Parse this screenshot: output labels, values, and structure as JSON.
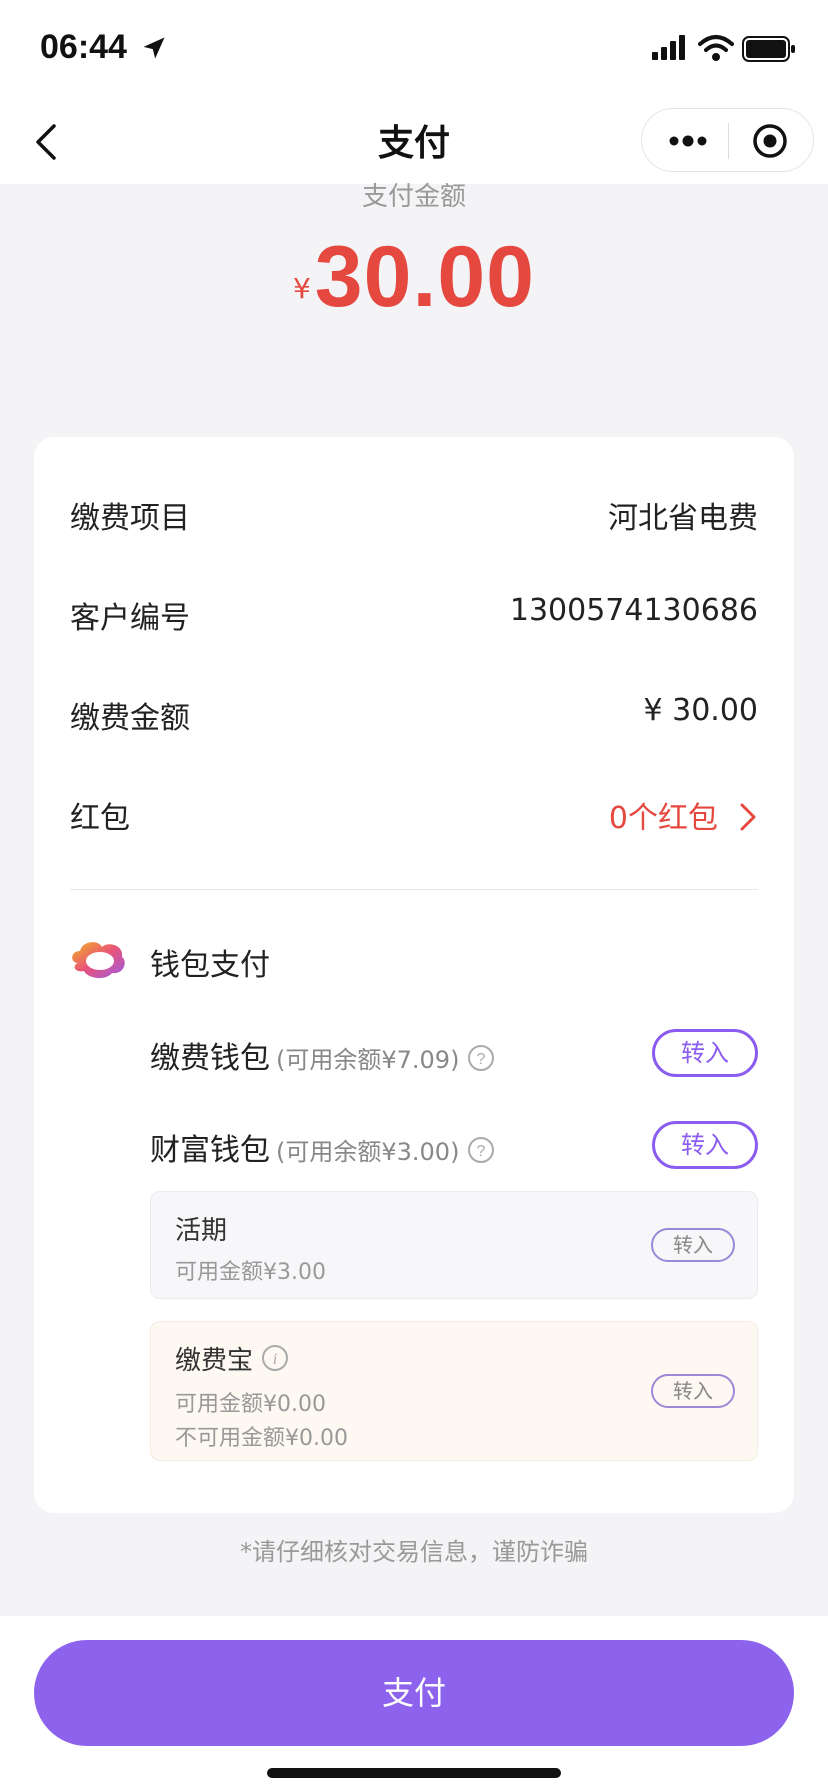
{
  "status_bar": {
    "time": "06:44"
  },
  "nav": {
    "title": "支付"
  },
  "amount": {
    "label": "支付金额",
    "currency": "¥",
    "value": "30.00"
  },
  "details": [
    {
      "label": "缴费项目",
      "value": "河北省电费"
    },
    {
      "label": "客户编号",
      "value": "1300574130686"
    },
    {
      "label": "缴费金额",
      "value": "¥ 30.00"
    },
    {
      "label": "红包",
      "value": "0个红包"
    }
  ],
  "wallet": {
    "title": "钱包支付",
    "items": [
      {
        "name": "缴费钱包",
        "balance": "(可用余额¥7.09)",
        "action": "转入"
      },
      {
        "name": "财富钱包",
        "balance": "(可用余额¥3.00)",
        "action": "转入"
      }
    ],
    "sub_items": [
      {
        "title": "活期",
        "lines": [
          "可用金额¥3.00"
        ],
        "action": "转入"
      },
      {
        "title": "缴费宝",
        "lines": [
          "可用金额¥0.00",
          "不可用金额¥0.00"
        ],
        "action": "转入"
      }
    ]
  },
  "notice": "*请仔细核对交易信息，谨防诈骗",
  "pay_button": {
    "label": "支付"
  },
  "colors": {
    "accent": "#8d63ee",
    "amount_red": "#e5483f",
    "background": "#f4f4f6"
  },
  "icons": [
    "location-arrow-icon",
    "signal-icon",
    "wifi-icon",
    "battery-icon",
    "back-chevron-icon",
    "more-dots-icon",
    "target-icon",
    "chevron-right-icon",
    "wallet-logo-icon",
    "help-question-icon",
    "info-icon"
  ]
}
